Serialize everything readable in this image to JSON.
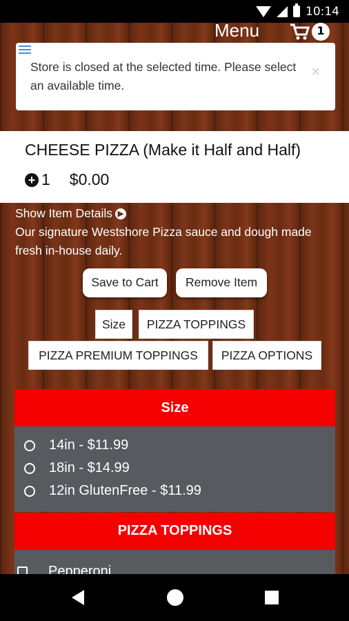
{
  "status_bar": {
    "time": "10:14"
  },
  "header": {
    "menu_label": "Menu",
    "cart_count": "1"
  },
  "alert": {
    "message": "Store is closed at the selected time. Please select an available time.",
    "close_symbol": "×"
  },
  "item": {
    "title": "CHEESE PIZZA (Make it Half and Half)",
    "quantity": "1",
    "price": "$0.00",
    "show_details_label": "Show Item Details",
    "description": "Our signature Westshore Pizza sauce and dough made fresh in-house daily."
  },
  "actions": {
    "save_label": "Save to Cart",
    "remove_label": "Remove Item"
  },
  "tabs": [
    "Size",
    "PIZZA TOPPINGS",
    "PIZZA PREMIUM TOPPINGS",
    "PIZZA OPTIONS"
  ],
  "sections": {
    "size": {
      "title": "Size",
      "options": [
        "14in - $11.99",
        "18in - $14.99",
        "12in GlutenFree - $11.99"
      ]
    },
    "toppings": {
      "title": "PIZZA TOPPINGS",
      "options": [
        "Pepperoni"
      ]
    }
  },
  "colors": {
    "section_header": "#f40000",
    "options_bg": "#575b5f",
    "alert_handle": "#4a90e2"
  }
}
